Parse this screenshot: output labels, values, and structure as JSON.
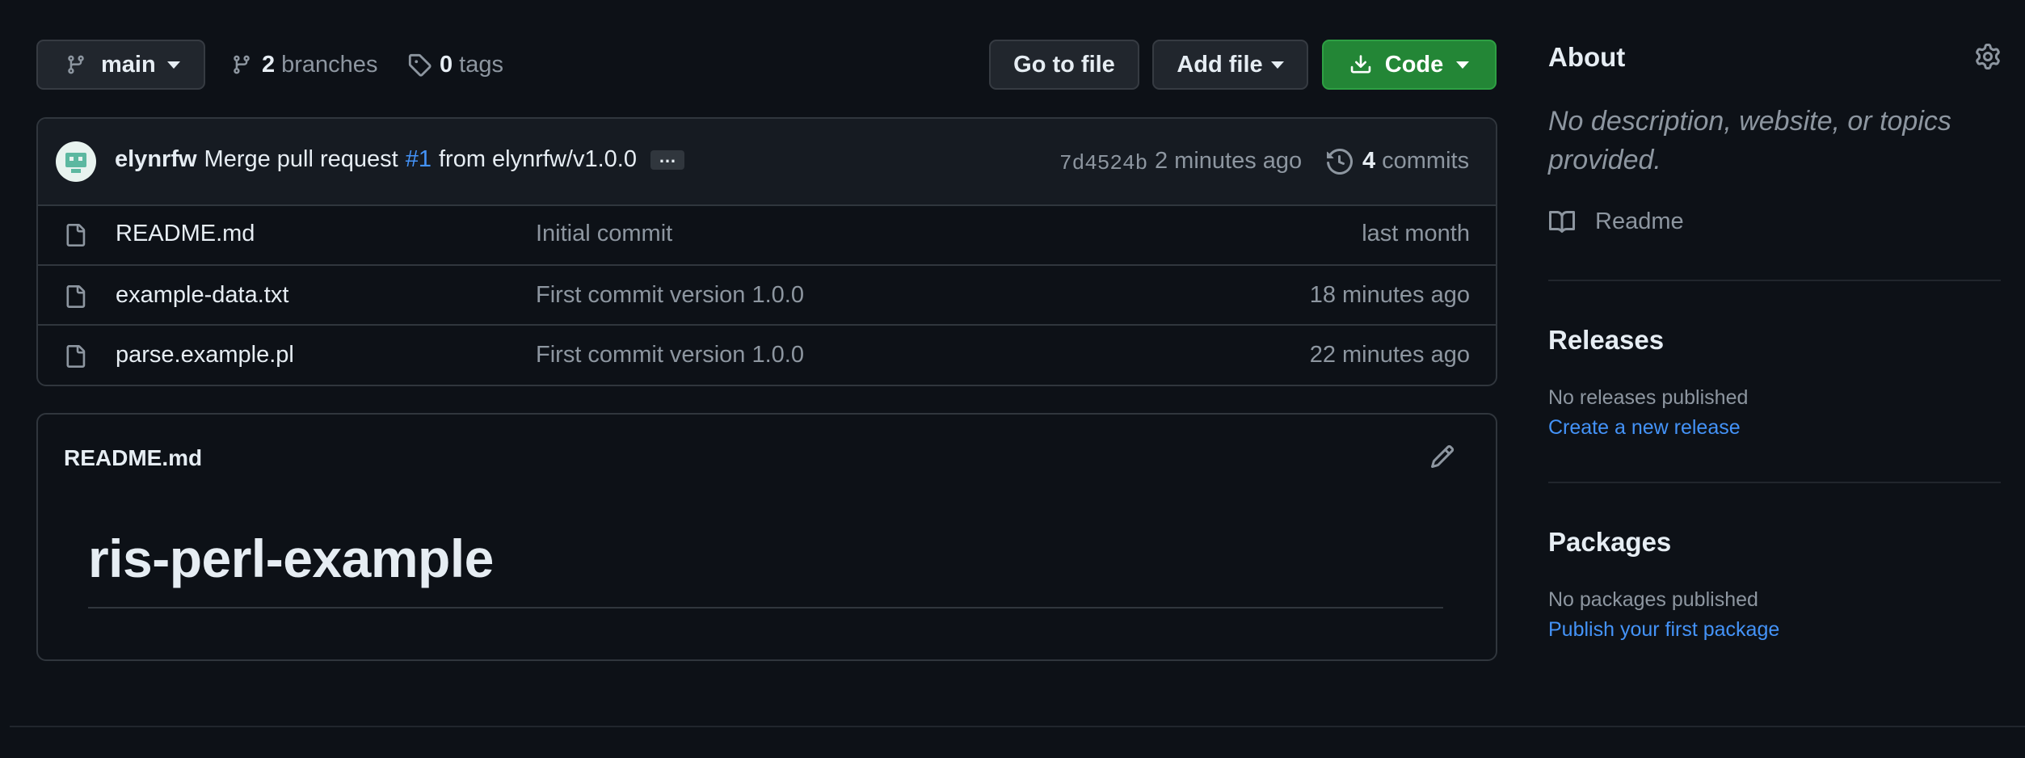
{
  "toolbar": {
    "branch_name": "main",
    "branches_count": "2",
    "branches_label": "branches",
    "tags_count": "0",
    "tags_label": "tags",
    "go_to_file": "Go to file",
    "add_file": "Add file",
    "code": "Code"
  },
  "commit": {
    "author": "elynrfw",
    "message_prefix": "Merge pull request",
    "pr_ref": "#1",
    "message_suffix": "from elynrfw/v1.0.0",
    "ellipsis": "…",
    "sha": "7d4524b",
    "time": "2 minutes ago",
    "commits_count": "4",
    "commits_label": "commits"
  },
  "files": [
    {
      "name": "README.md",
      "message": "Initial commit",
      "time": "last month"
    },
    {
      "name": "example-data.txt",
      "message": "First commit version 1.0.0",
      "time": "18 minutes ago"
    },
    {
      "name": "parse.example.pl",
      "message": "First commit version 1.0.0",
      "time": "22 minutes ago"
    }
  ],
  "readme": {
    "filename": "README.md",
    "heading": "ris-perl-example"
  },
  "sidebar": {
    "about_title": "About",
    "about_description": "No description, website, or topics provided.",
    "readme_label": "Readme",
    "releases_title": "Releases",
    "releases_empty": "No releases published",
    "releases_link": "Create a new release",
    "packages_title": "Packages",
    "packages_empty": "No packages published",
    "packages_link": "Publish your first package"
  },
  "colors": {
    "background": "#0d1117",
    "primary_button": "#238636",
    "link": "#4493f8",
    "muted_text": "#8d96a0"
  },
  "icons": [
    "branch-icon",
    "tag-icon",
    "download-icon",
    "history-icon",
    "file-icon",
    "pencil-icon",
    "gear-icon",
    "book-icon"
  ]
}
